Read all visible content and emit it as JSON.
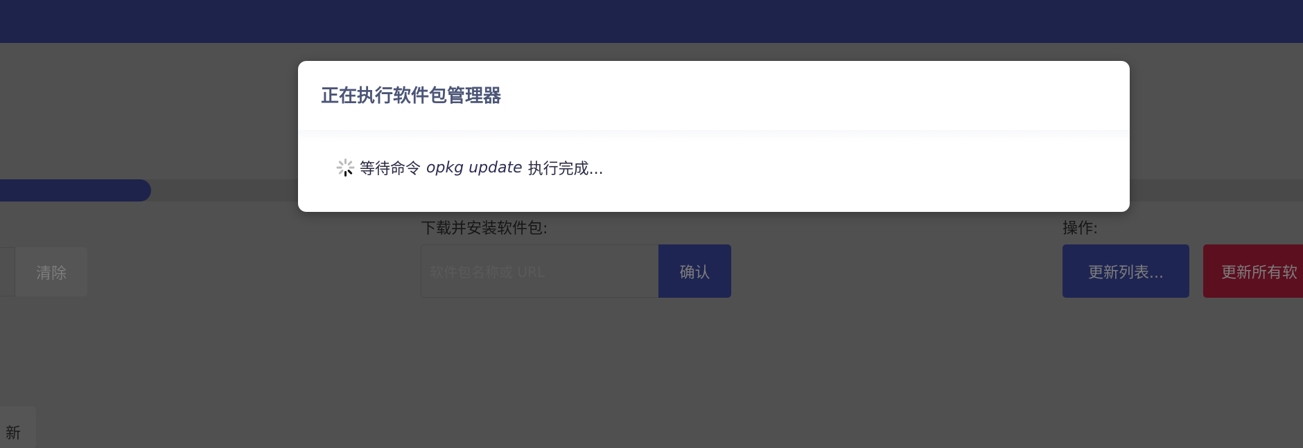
{
  "modal": {
    "title": "正在执行软件包管理器",
    "message_prefix": "等待命令",
    "command": "opkg update",
    "message_suffix": "执行完成..."
  },
  "progress": {
    "percent": 11.6,
    "fill_color": "#1e234c"
  },
  "filter": {
    "clear_label": "清除"
  },
  "install": {
    "label": "下载并安装软件包:",
    "placeholder": "软件包名称或 URL",
    "confirm_label": "确认"
  },
  "actions": {
    "label": "操作:",
    "update_lists_label": "更新列表...",
    "upgrade_all_label": "更新所有软"
  },
  "bottom": {
    "partial_button_label": "新"
  },
  "colors": {
    "primary": "#1e234c",
    "danger": "#5c0f1f",
    "header": "#1e234c"
  }
}
